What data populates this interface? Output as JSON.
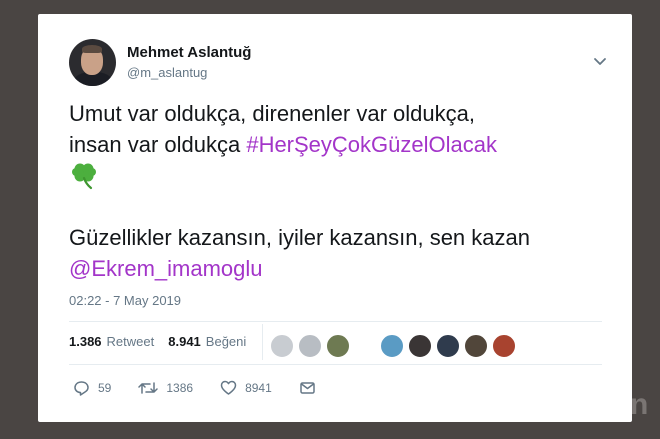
{
  "author": {
    "name": "Mehmet Aslantuğ",
    "handle": "@m_aslantug"
  },
  "tweet": {
    "line1": "Umut var oldukça, direnenler var oldukça,",
    "line2_text": "insan var oldukça ",
    "hashtag": "#HerŞeyÇokGüzelOlacak",
    "line3_text": "Güzellikler kazansın, iyiler kazansın, sen kazan",
    "mention": "@Ekrem_imamoglu",
    "emoji": "four-leaf-clover"
  },
  "timestamp": "02:22 - 7 May 2019",
  "stats": {
    "retweet_count": "1.386",
    "retweet_label": "Retweet",
    "like_count": "8.941",
    "like_label": "Beğeni"
  },
  "actions": {
    "replies": "59",
    "retweets": "1386",
    "likes": "8941"
  },
  "colors": {
    "link": "#a335c9",
    "clover": "#4caf3e",
    "text": "#14171a",
    "muted": "#657786"
  },
  "icons": [
    "chevron-down-icon",
    "reply-icon",
    "retweet-icon",
    "heart-icon",
    "message-icon"
  ],
  "watermark": "n"
}
